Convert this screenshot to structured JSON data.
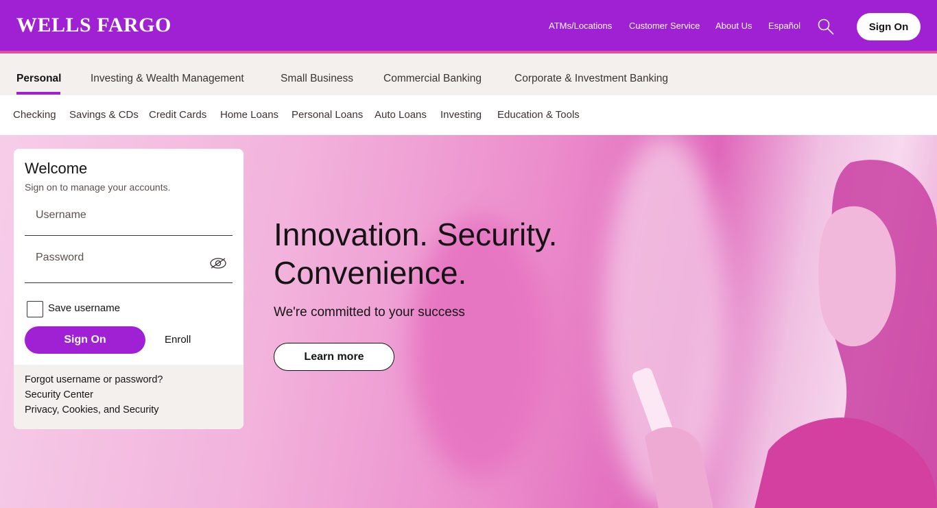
{
  "header": {
    "logo": "WELLS FARGO",
    "utility_links": [
      "ATMs/Locations",
      "Customer Service",
      "About Us",
      "Español"
    ],
    "search_icon": "search-icon",
    "sign_on_label": "Sign On",
    "brand_color": "#a020d4",
    "accent_color": "#e0509a"
  },
  "primary_nav": {
    "items": [
      "Personal",
      "Investing & Wealth Management",
      "Small Business",
      "Commercial Banking",
      "Corporate & Investment Banking"
    ],
    "active": "Personal"
  },
  "secondary_nav": {
    "items": [
      "Checking",
      "Savings & CDs",
      "Credit Cards",
      "Home Loans",
      "Personal Loans",
      "Auto Loans",
      "Investing",
      "Education & Tools"
    ]
  },
  "signon_card": {
    "title": "Welcome",
    "subtitle": "Sign on to manage your accounts.",
    "username_placeholder": "Username",
    "password_placeholder": "Password",
    "show_password_icon": "eye-slash-icon",
    "save_username_label": "Save username",
    "save_username_checked": false,
    "sign_on_label": "Sign On",
    "enroll_label": "Enroll",
    "footer_links": [
      "Forgot username or password?",
      "Security Center",
      "Privacy, Cookies, and Security"
    ]
  },
  "hero": {
    "headline_line1": "Innovation. Security.",
    "headline_line2": "Convenience.",
    "subheadline": "We're committed to your success",
    "cta_label": "Learn more"
  }
}
